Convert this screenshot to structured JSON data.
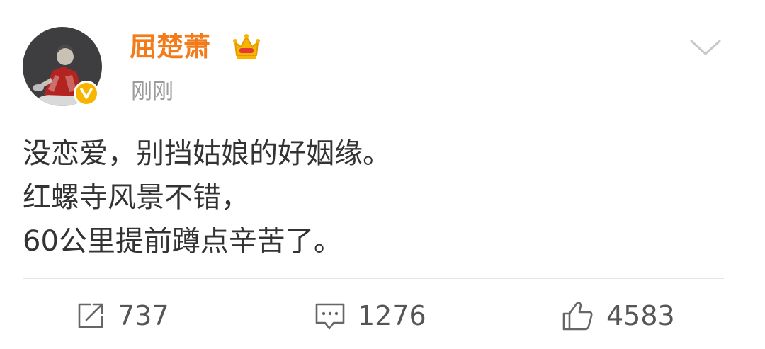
{
  "user": {
    "name": "屈楚萧",
    "avatar": "avatar",
    "verified_icon": "verified-badge-icon",
    "member_icon": "crown-icon",
    "colors": {
      "name": "#f27c1b",
      "verified_badge": "#f7b500"
    }
  },
  "post": {
    "time": "刚刚",
    "lines": [
      "没恋爱，别挡姑娘的好姻缘。",
      "红螺寺风景不错，",
      "60公里提前蹲点辛苦了。"
    ],
    "menu_icon": "chevron-down-icon"
  },
  "actions": {
    "repost": {
      "icon": "repost-icon",
      "count": "737"
    },
    "comment": {
      "icon": "comment-icon",
      "count": "1276"
    },
    "like": {
      "icon": "thumbs-up-icon",
      "count": "4583"
    }
  }
}
